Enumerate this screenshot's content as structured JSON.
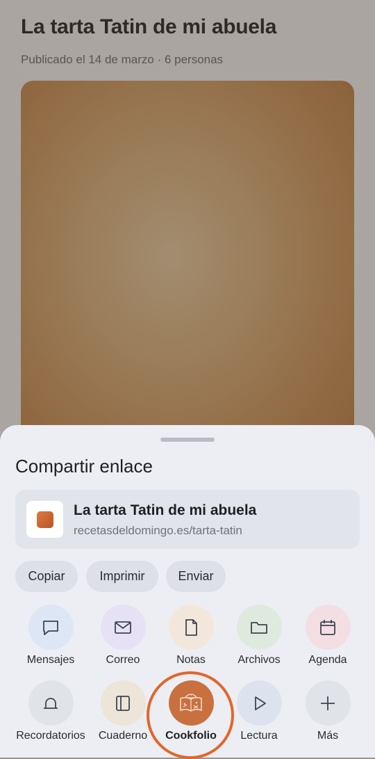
{
  "article": {
    "title": "La tarta Tatin de mi abuela",
    "meta": "Publicado el 14 de marzo · 6 personas"
  },
  "share_sheet": {
    "title": "Compartir enlace",
    "link": {
      "title": "La tarta Tatin de mi abuela",
      "url": "recetasdeldomingo.es/tarta-tatin"
    },
    "actions": [
      {
        "label": "Copiar"
      },
      {
        "label": "Imprimir"
      },
      {
        "label": "Enviar"
      }
    ],
    "apps": [
      {
        "label": "Mensajes",
        "icon": "message-bubble-icon",
        "color": "#dde6f5"
      },
      {
        "label": "Correo",
        "icon": "envelope-icon",
        "color": "#e6e1f4"
      },
      {
        "label": "Notas",
        "icon": "document-icon",
        "color": "#f3e7dc"
      },
      {
        "label": "Archivos",
        "icon": "folder-icon",
        "color": "#dfeadf"
      },
      {
        "label": "Agenda",
        "icon": "calendar-icon",
        "color": "#f3dfe3"
      },
      {
        "label": "Recordatorios",
        "icon": "bell-icon",
        "color": "#e0e3e8"
      },
      {
        "label": "Cuaderno",
        "icon": "notebook-icon",
        "color": "#ece5d8"
      },
      {
        "label": "Cookfolio",
        "icon": "cookbook-icon",
        "color": "#c9703f",
        "selected": true
      },
      {
        "label": "Lectura",
        "icon": "play-icon",
        "color": "#dce3ee"
      },
      {
        "label": "Más",
        "icon": "plus-icon",
        "color": "#e0e3e8"
      }
    ]
  }
}
